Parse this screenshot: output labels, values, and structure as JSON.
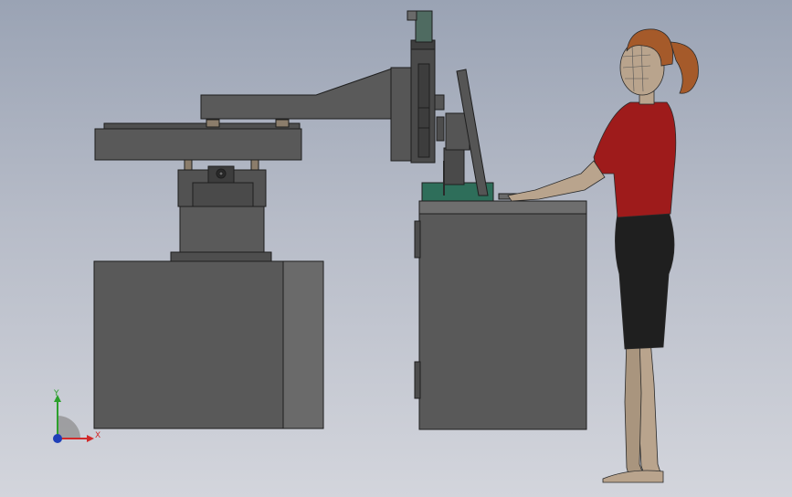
{
  "viewport": {
    "background_top": "#9aa3b4",
    "background_bottom": "#d3d5dc"
  },
  "colors": {
    "machine_body": "#595959",
    "machine_side": "#6a6a6a",
    "machine_dark": "#3d3d3d",
    "edge": "#1e1e1e",
    "monitor_base_accent": "#2e6e5a",
    "shirt": "#9e1b1b",
    "shorts": "#1f1f1f",
    "skin": "#b9a48d",
    "hair": "#a55a2a"
  },
  "triad": {
    "x_label": "X",
    "y_label": "Y",
    "x_color": "#d12a2a",
    "y_color": "#2ca02c",
    "z_color": "#1f3fb8",
    "x_icon": "x-axis-arrow-icon",
    "y_icon": "y-axis-arrow-icon",
    "z_icon": "z-axis-origin-icon"
  }
}
